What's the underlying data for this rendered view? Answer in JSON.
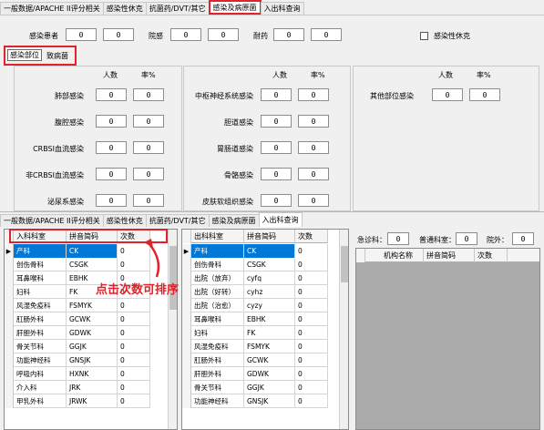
{
  "top_tabs": [
    "一般数据/APACHE II评分相关",
    "感染性休克",
    "抗菌药/DVT/其它",
    "感染及病原菌",
    "入出科查询"
  ],
  "top_tab_selected": 3,
  "summary": {
    "infected_patients_label": "感染患者",
    "infected_patients_a": "0",
    "infected_patients_b": "0",
    "hospital_infection_label": "院感",
    "hospital_infection_a": "0",
    "hospital_infection_b": "0",
    "drug_resistance_label": "耐药",
    "drug_resistance_a": "0",
    "drug_resistance_b": "0",
    "septic_shock_label": "感染性休克"
  },
  "sub_tabs": [
    "感染部位",
    "致病菌"
  ],
  "panel_headers": {
    "count": "人数",
    "rate": "率%"
  },
  "panel1": [
    {
      "label": "肺部感染",
      "count": "0",
      "rate": "0"
    },
    {
      "label": "腹腔感染",
      "count": "0",
      "rate": "0"
    },
    {
      "label": "CRBSI血流感染",
      "count": "0",
      "rate": "0"
    },
    {
      "label": "非CRBSI血流感染",
      "count": "0",
      "rate": "0"
    },
    {
      "label": "泌尿系感染",
      "count": "0",
      "rate": "0"
    }
  ],
  "panel2": [
    {
      "label": "中枢神经系统感染",
      "count": "0",
      "rate": "0"
    },
    {
      "label": "胆道感染",
      "count": "0",
      "rate": "0"
    },
    {
      "label": "胃肠道感染",
      "count": "0",
      "rate": "0"
    },
    {
      "label": "骨骼感染",
      "count": "0",
      "rate": "0"
    },
    {
      "label": "皮肤软组织感染",
      "count": "0",
      "rate": "0"
    }
  ],
  "panel3": [
    {
      "label": "其他部位感染",
      "count": "0",
      "rate": "0"
    }
  ],
  "bottom_tabs": [
    "一般数据/APACHE II评分相关",
    "感染性休克",
    "抗菌药/DVT/其它",
    "感染及病原菌",
    "入出科查询"
  ],
  "bottom_tab_selected": 4,
  "grid1": {
    "headers": [
      "入科科室",
      "拼音简码",
      "次数"
    ],
    "rows": [
      [
        "产科",
        "CK",
        "0"
      ],
      [
        "创伤骨科",
        "CSGK",
        "0"
      ],
      [
        "耳鼻喉科",
        "EBHK",
        "0"
      ],
      [
        "妇科",
        "FK",
        "0"
      ],
      [
        "风湿免疫科",
        "FSMYK",
        "0"
      ],
      [
        "肛肠外科",
        "GCWK",
        "0"
      ],
      [
        "肝胆外科",
        "GDWK",
        "0"
      ],
      [
        "骨关节科",
        "GGJK",
        "0"
      ],
      [
        "功能神经科",
        "GNSJK",
        "0"
      ],
      [
        "呼吸内科",
        "HXNK",
        "0"
      ],
      [
        "介入科",
        "JRK",
        "0"
      ],
      [
        "甲乳外科",
        "JRWK",
        "0"
      ]
    ]
  },
  "grid2": {
    "headers": [
      "出科科室",
      "拼音简码",
      "次数"
    ],
    "rows": [
      [
        "产科",
        "CK",
        "0"
      ],
      [
        "创伤骨科",
        "CSGK",
        "0"
      ],
      [
        "出院（放弃）",
        "cyfq",
        "0"
      ],
      [
        "出院（好转）",
        "cyhz",
        "0"
      ],
      [
        "出院（治愈）",
        "cyzy",
        "0"
      ],
      [
        "耳鼻喉科",
        "EBHK",
        "0"
      ],
      [
        "妇科",
        "FK",
        "0"
      ],
      [
        "风湿免疫科",
        "FSMYK",
        "0"
      ],
      [
        "肛肠外科",
        "GCWK",
        "0"
      ],
      [
        "肝胆外科",
        "GDWK",
        "0"
      ],
      [
        "骨关节科",
        "GGJK",
        "0"
      ],
      [
        "功能神经科",
        "GNSJK",
        "0"
      ]
    ]
  },
  "right_summary": {
    "emergency_label": "急诊科：",
    "emergency_value": "0",
    "general_label": "普通科室：",
    "general_value": "0",
    "outside_label": "院外：",
    "outside_value": "0"
  },
  "grid3": {
    "headers": [
      "机构名称",
      "拼音简码",
      "次数"
    ]
  },
  "annotation": "点击次数可排序",
  "colors": {
    "highlight_red": "#e0222a",
    "selection_blue": "#0078d7"
  }
}
